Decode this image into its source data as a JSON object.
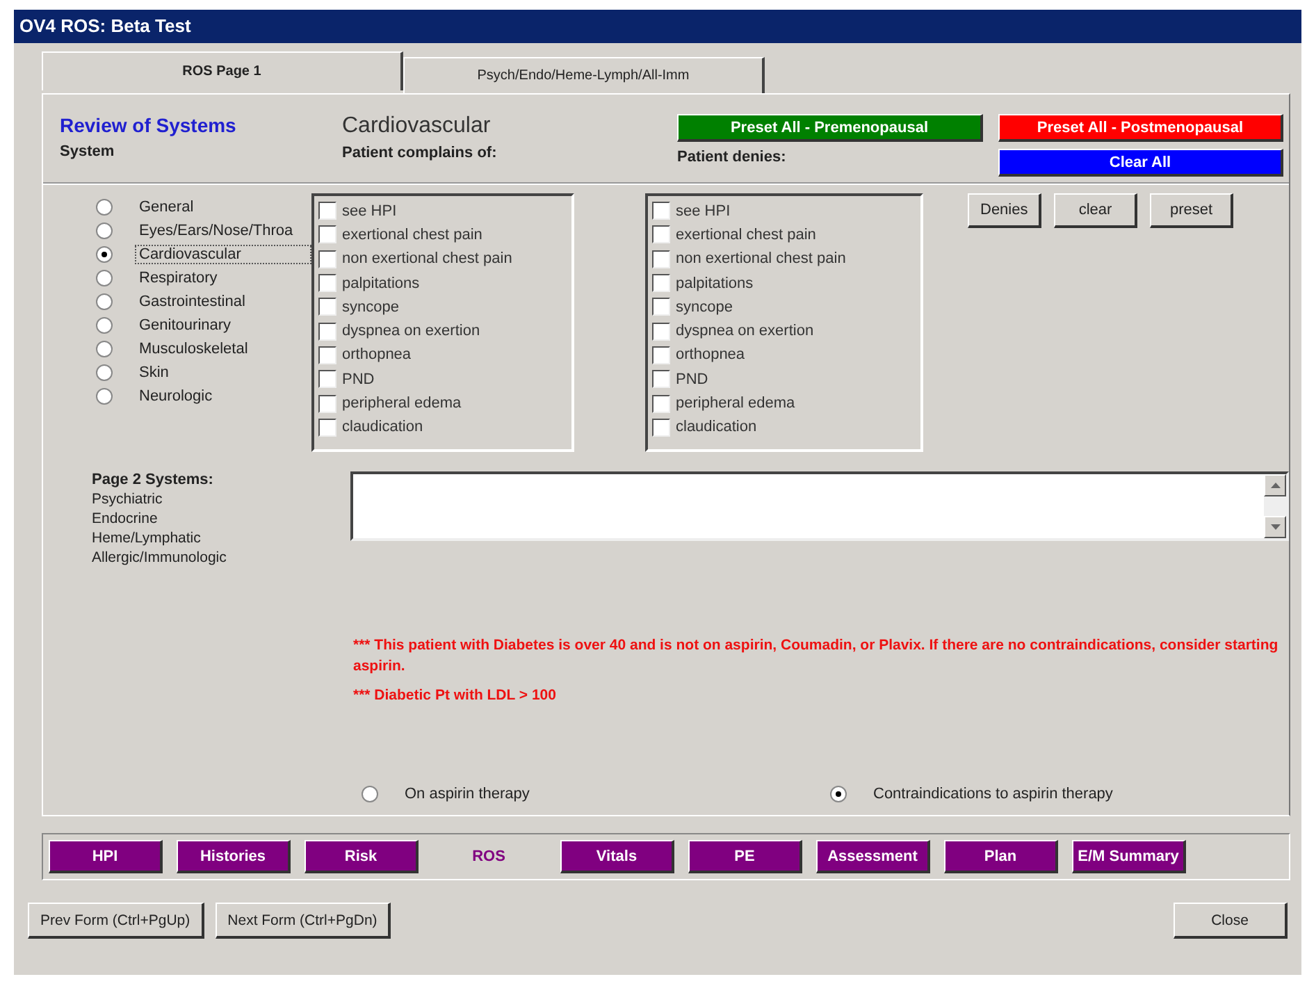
{
  "window": {
    "title": "OV4 ROS:  Beta Test"
  },
  "tabs": [
    {
      "label": "ROS Page 1",
      "selected": true
    },
    {
      "label": "Psych/Endo/Heme-Lymph/All-Imm",
      "selected": false
    }
  ],
  "heading": "Review of Systems",
  "current_system": "Cardiovascular",
  "preset_buttons": [
    {
      "label": "Preset All - Premenopausal",
      "color": "#008000"
    },
    {
      "label": "Preset All - Postmenopausal",
      "color": "#ff0000"
    },
    {
      "label": "Clear All",
      "color": "#0000ff"
    }
  ],
  "system_label": "System",
  "complains_label": "Patient complains of:",
  "denies_label": "Patient denies:",
  "systems": [
    {
      "label": "General",
      "selected": false
    },
    {
      "label": "Eyes/Ears/Nose/Throa",
      "selected": false
    },
    {
      "label": "Cardiovascular",
      "selected": true
    },
    {
      "label": "Respiratory",
      "selected": false
    },
    {
      "label": "Gastrointestinal",
      "selected": false
    },
    {
      "label": "Genitourinary",
      "selected": false
    },
    {
      "label": "Musculoskeletal",
      "selected": false
    },
    {
      "label": "Skin",
      "selected": false
    },
    {
      "label": "Neurologic",
      "selected": false
    }
  ],
  "complains": [
    {
      "label": "see HPI",
      "checked": false
    },
    {
      "label": "exertional chest pain",
      "checked": false
    },
    {
      "label": "non exertional chest pain",
      "checked": false
    },
    {
      "label": "palpitations",
      "checked": false
    },
    {
      "label": "syncope",
      "checked": false
    },
    {
      "label": "dyspnea on exertion",
      "checked": false
    },
    {
      "label": "orthopnea",
      "checked": false
    },
    {
      "label": "PND",
      "checked": false
    },
    {
      "label": "peripheral edema",
      "checked": false
    },
    {
      "label": "claudication",
      "checked": false
    }
  ],
  "denies": [
    {
      "label": "see HPI",
      "checked": false
    },
    {
      "label": "exertional chest pain",
      "checked": false
    },
    {
      "label": "non exertional chest pain",
      "checked": false
    },
    {
      "label": "palpitations",
      "checked": false
    },
    {
      "label": "syncope",
      "checked": false
    },
    {
      "label": "dyspnea on exertion",
      "checked": false
    },
    {
      "label": "orthopnea",
      "checked": false
    },
    {
      "label": "PND",
      "checked": false
    },
    {
      "label": "peripheral edema",
      "checked": false
    },
    {
      "label": "claudication",
      "checked": false
    }
  ],
  "side_buttons": [
    "Denies",
    "clear",
    "preset"
  ],
  "page2": {
    "label": "Page 2 Systems:",
    "items": [
      "Psychiatric",
      "Endocrine",
      "Heme/Lymphatic",
      "Allergic/Immunologic"
    ]
  },
  "alerts": [
    "*** This patient with Diabetes is over 40 and is not on aspirin, Coumadin, or Plavix. If there are no contraindications, consider starting aspirin.",
    "*** Diabetic Pt with LDL > 100"
  ],
  "aspirin": [
    {
      "label": "On aspirin therapy",
      "selected": false
    },
    {
      "label": "Contraindications to aspirin therapy",
      "selected": true
    }
  ],
  "nav": [
    {
      "label": "HPI",
      "selected": false
    },
    {
      "label": "Histories",
      "selected": false
    },
    {
      "label": "Risk",
      "selected": false
    },
    {
      "label": "ROS",
      "selected": true
    },
    {
      "label": "Vitals",
      "selected": false
    },
    {
      "label": "PE",
      "selected": false
    },
    {
      "label": "Assessment",
      "selected": false
    },
    {
      "label": "Plan",
      "selected": false
    },
    {
      "label": "E/M Summary",
      "selected": false
    }
  ],
  "footer_buttons": [
    "Prev Form (Ctrl+PgUp)",
    "Next Form (Ctrl+PgDn)",
    "Close"
  ]
}
